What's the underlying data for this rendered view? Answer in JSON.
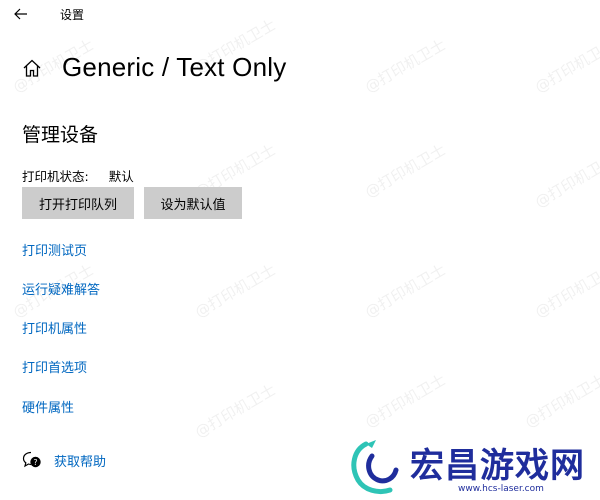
{
  "window": {
    "title": "设置",
    "back_icon": "arrow-left-icon"
  },
  "header": {
    "home_icon": "home-icon",
    "title": "Generic / Text Only"
  },
  "section": {
    "title": "管理设备"
  },
  "status": {
    "label": "打印机状态:",
    "value": "默认"
  },
  "buttons": {
    "open_queue": "打开打印队列",
    "set_default": "设为默认值"
  },
  "links": [
    "打印测试页",
    "运行疑难解答",
    "打印机属性",
    "打印首选项",
    "硬件属性"
  ],
  "help": {
    "icon": "chat-help-icon",
    "label": "获取帮助"
  },
  "watermark": "@打印机卫士",
  "logo": {
    "text": "宏昌游戏网",
    "url": "www.hcs-laser.com"
  },
  "colors": {
    "link": "#0067c0",
    "button_bg": "#cccccc",
    "logo": "#1f2d9c",
    "logo_accent": "#2ec4b6"
  }
}
